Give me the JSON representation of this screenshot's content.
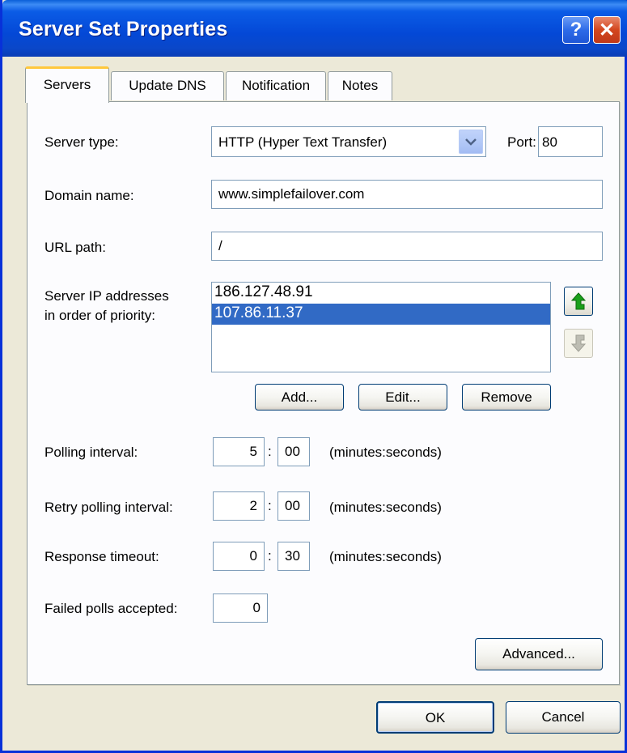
{
  "window": {
    "title": "Server Set Properties",
    "help_glyph": "?",
    "close_glyph": "✕"
  },
  "tabs": [
    {
      "label": "Servers",
      "active": true
    },
    {
      "label": "Update DNS",
      "active": false
    },
    {
      "label": "Notification",
      "active": false
    },
    {
      "label": "Notes",
      "active": false
    }
  ],
  "form": {
    "server_type_label": "Server type:",
    "server_type_value": "HTTP (Hyper Text Transfer)",
    "port_label": "Port:",
    "port_value": "80",
    "domain_label": "Domain name:",
    "domain_value": "www.simplefailover.com",
    "url_label": "URL path:",
    "url_value": "/",
    "ip_label_line1": "Server IP addresses",
    "ip_label_line2": "in order of priority:",
    "ip_list": [
      "186.127.48.91",
      "107.86.11.37"
    ],
    "ip_selected_index": 1,
    "add_label": "Add...",
    "edit_label": "Edit...",
    "remove_label": "Remove",
    "polling_label": "Polling interval:",
    "polling_min": "5",
    "polling_sec": "00",
    "retry_label": "Retry polling interval:",
    "retry_min": "2",
    "retry_sec": "00",
    "timeout_label": "Response timeout:",
    "timeout_min": "0",
    "timeout_sec": "30",
    "units_label": "(minutes:seconds)",
    "colon": ":",
    "failed_label": "Failed polls accepted:",
    "failed_value": "0",
    "advanced_label": "Advanced..."
  },
  "footer": {
    "ok_label": "OK",
    "cancel_label": "Cancel"
  },
  "icons": {
    "move_up": "arrow-up-icon",
    "move_down": "arrow-down-icon",
    "dropdown": "chevron-down-icon"
  },
  "colors": {
    "titlebar": "#0a47c9",
    "selection": "#316ac5",
    "arrow_green": "#1aa01a"
  }
}
